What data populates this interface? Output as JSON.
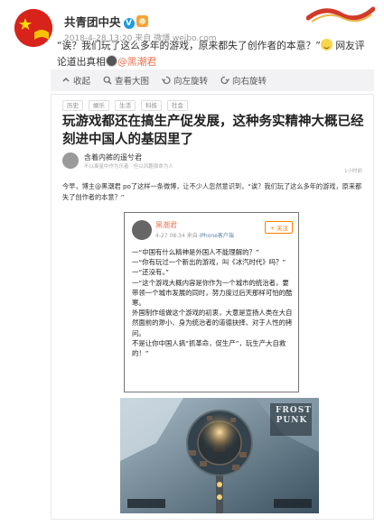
{
  "header": {
    "username": "共青团中央",
    "verified_badge": "V",
    "meta": "2018-4-28 13:20 来自 微博 weibo.com"
  },
  "post": {
    "text_part1": "“诶？我们玩了这么多年的游戏，原来都失了创作者的本意？”",
    "text_part2": " 网友评论道出真相",
    "mention": "@黑潮君"
  },
  "toolbar": {
    "items": [
      {
        "label": "收起",
        "icon": "collapse-icon"
      },
      {
        "label": "查看大图",
        "icon": "zoom-icon"
      },
      {
        "label": "向左旋转",
        "icon": "rotate-left-icon"
      },
      {
        "label": "向右旋转",
        "icon": "rotate-right-icon"
      }
    ]
  },
  "article": {
    "tags": [
      "历史",
      "娱乐",
      "生活",
      "科技",
      "社会"
    ],
    "title": "玩游戏都还在搞生产促发展，这种务实精神大概已经刻进中国人的基因里了",
    "author_name": "含着内裤的遥兮君",
    "author_sub": "不以离星中作为乐者 · 但以风趣宿命为人",
    "time_ago": "1小时前",
    "intro": "今早，博主@黑潮君 po了这样一条微博，让不少人忽然意识到，“诶？我们玩了这么多年的游戏，原来都失了创作者的本意？”"
  },
  "quote": {
    "name": "黑潮君",
    "meta_time": "4-27 08:34 来自 ",
    "meta_source": "iPhone客户端",
    "follow_label": "+ 关注",
    "lines": [
      "一“中国有什么精神是外国人不能理解的？”",
      "一“你有玩过一个新出的游戏，叫《冰汽时代》吗？”",
      "一“还没有。”",
      "一“这个游戏大概内容是你作为一个城市的统治者，要带领一个城市发展的同时，努力度过后天那样可怕的酷寒。",
      "外国制作组做这个游戏的初衷，大意是宣扬人类在大自然面前的渺小、身为统治者的道德抉择、对于人性的拷问。",
      "不是让你中国人搞“抓革命，促生产”，玩生产大自救的！”"
    ]
  },
  "game": {
    "logo_text": "FROST PUNK"
  },
  "colors": {
    "accent_orange": "#eb7350",
    "link_blue": "#5d7ea8",
    "verified_blue": "#1a9bdc"
  }
}
